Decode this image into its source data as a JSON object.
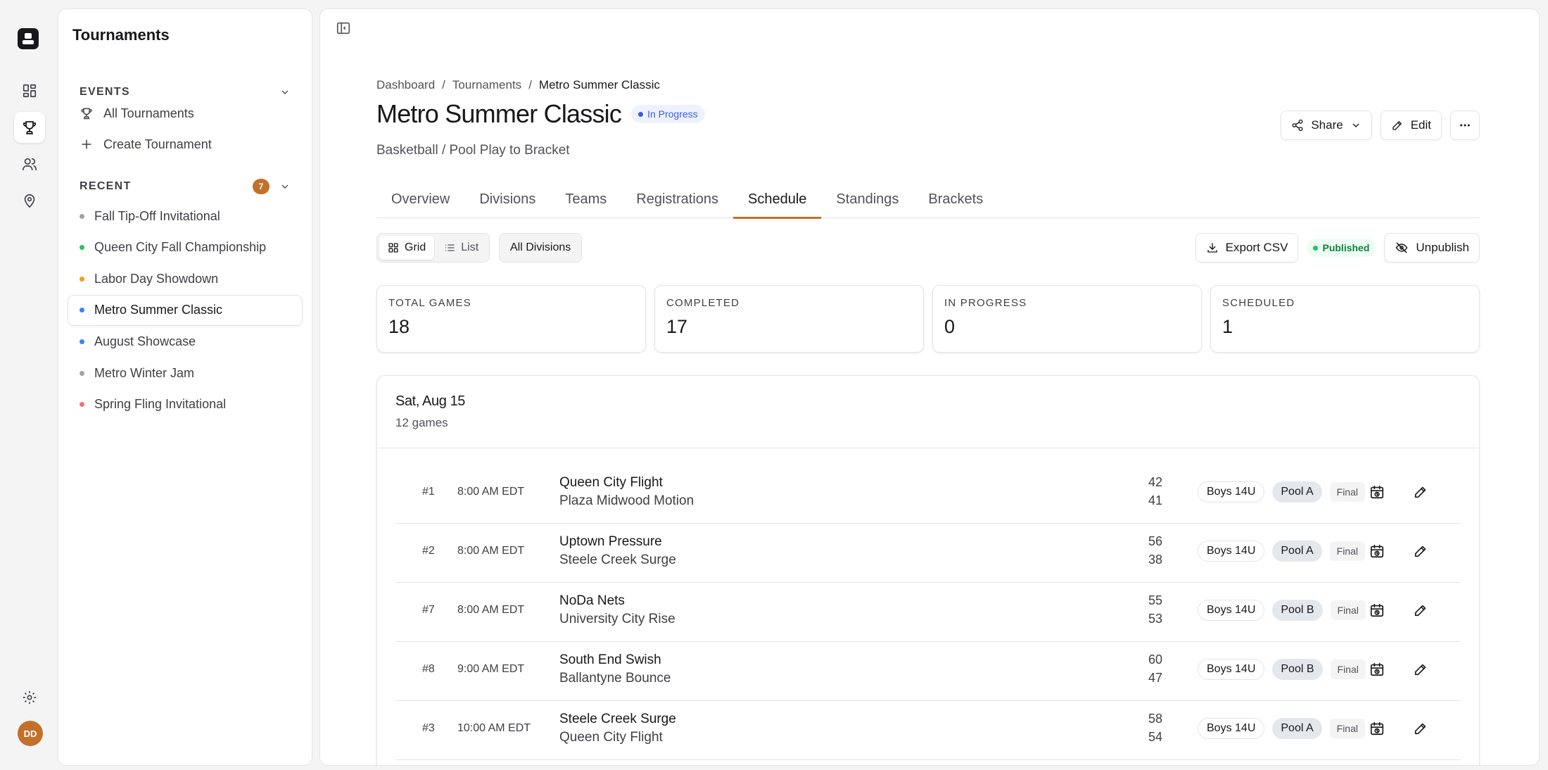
{
  "sidebar": {
    "title": "Tournaments",
    "events_heading": "EVENTS",
    "nav": [
      {
        "label": "All Tournaments",
        "icon": "trophy-icon"
      },
      {
        "label": "Create Tournament",
        "icon": "plus-icon"
      }
    ],
    "recent_heading": "RECENT",
    "recent_count": "7",
    "recent": [
      {
        "label": "Fall Tip-Off Invitational",
        "dot": "#a1a1aa"
      },
      {
        "label": "Queen City Fall Championship",
        "dot": "#22c55e"
      },
      {
        "label": "Labor Day Showdown",
        "dot": "#f59e0b"
      },
      {
        "label": "Metro Summer Classic",
        "dot": "#3b82f6"
      },
      {
        "label": "August Showcase",
        "dot": "#3b82f6"
      },
      {
        "label": "Metro Winter Jam",
        "dot": "#a1a1aa"
      },
      {
        "label": "Spring Fling Invitational",
        "dot": "#f87171"
      }
    ]
  },
  "user": {
    "initials": "DD",
    "avatar_color": "#c2702a"
  },
  "breadcrumb": [
    "Dashboard",
    "Tournaments",
    "Metro Summer Classic"
  ],
  "page": {
    "title": "Metro Summer Classic",
    "status": "In Progress",
    "subtitle": "Basketball / Pool Play to Bracket"
  },
  "actions": {
    "share": "Share",
    "edit": "Edit"
  },
  "tabs": [
    "Overview",
    "Divisions",
    "Teams",
    "Registrations",
    "Schedule",
    "Standings",
    "Brackets"
  ],
  "active_tab": "Schedule",
  "toolbar": {
    "grid": "Grid",
    "list": "List",
    "divisions_filter": "All Divisions",
    "export": "Export CSV",
    "published": "Published",
    "unpublish": "Unpublish"
  },
  "stats": [
    {
      "label": "TOTAL GAMES",
      "value": "18"
    },
    {
      "label": "COMPLETED",
      "value": "17"
    },
    {
      "label": "IN PROGRESS",
      "value": "0"
    },
    {
      "label": "SCHEDULED",
      "value": "1"
    }
  ],
  "schedule": {
    "day": "Sat, Aug 15",
    "games_count": "12 games",
    "games": [
      {
        "num": "#1",
        "time": "8:00 AM EDT",
        "home": "Queen City Flight",
        "away": "Plaza Midwood Motion",
        "home_score": "42",
        "away_score": "41",
        "division": "Boys 14U",
        "pool": "Pool A",
        "status": "Final"
      },
      {
        "num": "#2",
        "time": "8:00 AM EDT",
        "home": "Uptown Pressure",
        "away": "Steele Creek Surge",
        "home_score": "56",
        "away_score": "38",
        "division": "Boys 14U",
        "pool": "Pool A",
        "status": "Final"
      },
      {
        "num": "#7",
        "time": "8:00 AM EDT",
        "home": "NoDa Nets",
        "away": "University City Rise",
        "home_score": "55",
        "away_score": "53",
        "division": "Boys 14U",
        "pool": "Pool B",
        "status": "Final"
      },
      {
        "num": "#8",
        "time": "9:00 AM EDT",
        "home": "South End Swish",
        "away": "Ballantyne Bounce",
        "home_score": "60",
        "away_score": "47",
        "division": "Boys 14U",
        "pool": "Pool B",
        "status": "Final"
      },
      {
        "num": "#3",
        "time": "10:00 AM EDT",
        "home": "Steele Creek Surge",
        "away": "Queen City Flight",
        "home_score": "58",
        "away_score": "54",
        "division": "Boys 14U",
        "pool": "Pool A",
        "status": "Final"
      }
    ]
  }
}
